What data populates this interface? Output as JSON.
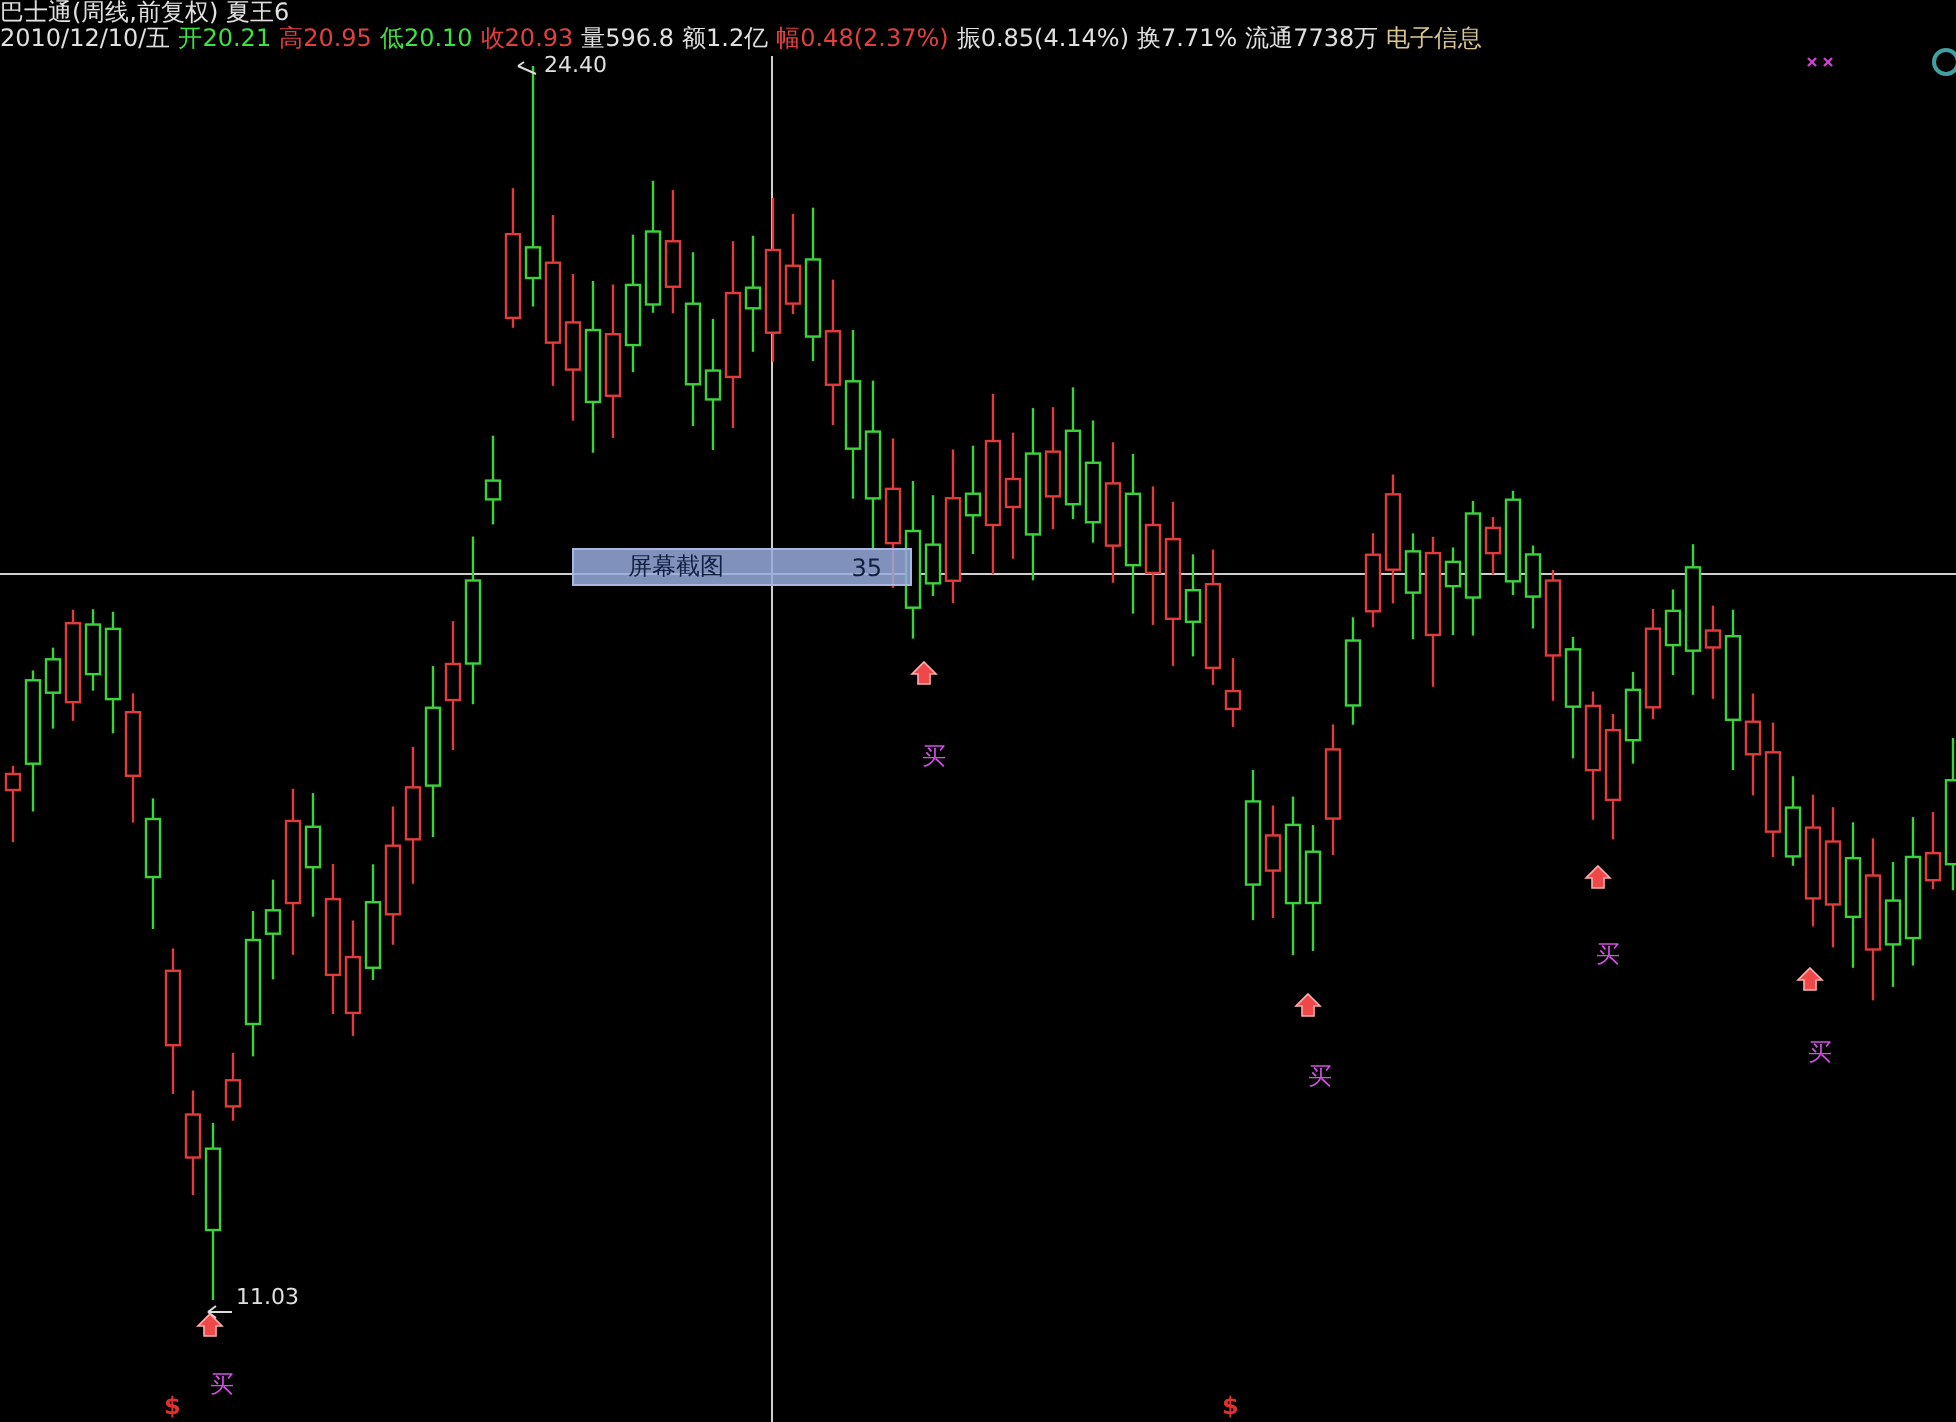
{
  "title": "巴士通(周线,前复权) 夏王6",
  "quote": [
    {
      "text": "2010/12/10/五",
      "color": "#e0e0e0"
    },
    {
      "text": "开20.21",
      "color": "#40e040"
    },
    {
      "text": "高20.95",
      "color": "#e04040"
    },
    {
      "text": "低20.10",
      "color": "#40e040"
    },
    {
      "text": "收20.93",
      "color": "#e04040"
    },
    {
      "text": "量596.8",
      "color": "#e0e0e0"
    },
    {
      "text": "额1.2亿",
      "color": "#e0e0e0"
    },
    {
      "text": "幅0.48(2.37%)",
      "color": "#e04040"
    },
    {
      "text": "振0.85(4.14%)",
      "color": "#e0e0e0"
    },
    {
      "text": "换7.71%",
      "color": "#e0e0e0"
    },
    {
      "text": "流通7738万",
      "color": "#e0e0e0"
    },
    {
      "text": "电子信息",
      "color": "#d8c890"
    }
  ],
  "price_labels": [
    {
      "text": "24.40"
    },
    {
      "text": "11.03"
    }
  ],
  "tooltip": {
    "label": "屏幕截图",
    "value": "35"
  },
  "signals": [
    {
      "text": "买"
    },
    {
      "text": "买"
    },
    {
      "text": "买"
    },
    {
      "text": "买"
    },
    {
      "text": "买"
    }
  ],
  "markers": [
    {
      "text": "$"
    },
    {
      "text": "$"
    }
  ]
}
